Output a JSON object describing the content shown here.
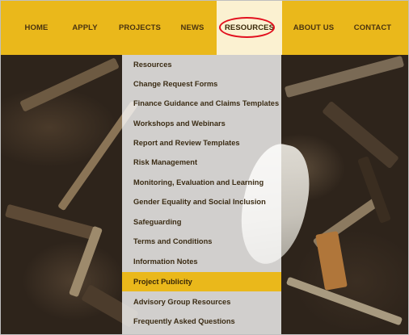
{
  "nav": {
    "items": [
      {
        "label": "HOME",
        "active": false
      },
      {
        "label": "APPLY",
        "active": false
      },
      {
        "label": "PROJECTS",
        "active": false
      },
      {
        "label": "NEWS",
        "active": false
      },
      {
        "label": "RESOURCES",
        "active": true
      },
      {
        "label": "ABOUT US",
        "active": false
      },
      {
        "label": "CONTACT",
        "active": false
      }
    ]
  },
  "dropdown": {
    "items": [
      "Resources",
      "Change Request Forms",
      "Finance Guidance and Claims Templates",
      "Workshops and Webinars",
      "Report and Review Templates",
      "Risk Management",
      "Monitoring, Evaluation and Learning",
      "Gender Equality and Social Inclusion",
      "Safeguarding",
      "Terms and Conditions",
      "Information Notes",
      "Project Publicity",
      "Advisory Group Resources",
      "Frequently Asked Questions"
    ],
    "highlighted": "Project Publicity"
  },
  "colors": {
    "nav_background": "#eab81b",
    "active_tab_background": "#fbf1d1",
    "annotation_circle": "#e2101e",
    "highlight_background": "#eab81b"
  }
}
